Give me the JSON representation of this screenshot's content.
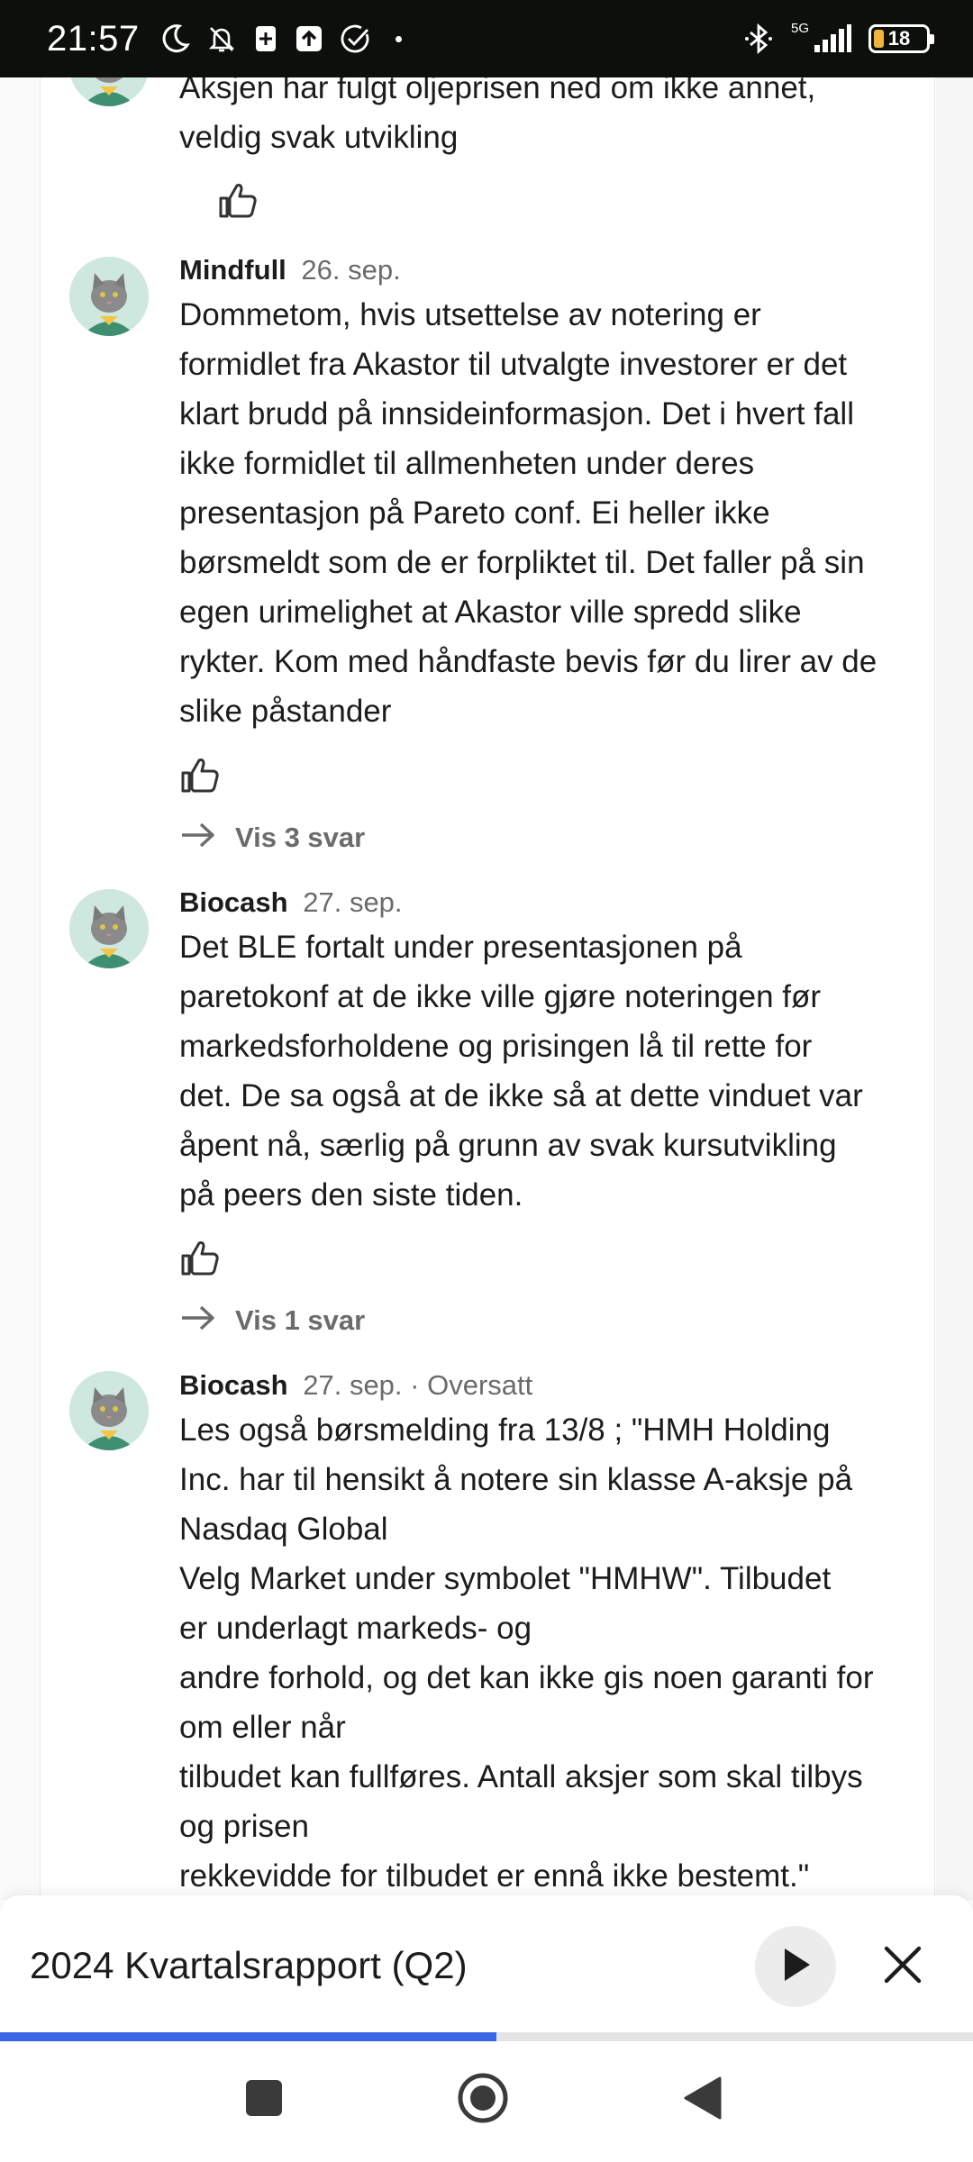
{
  "status_bar": {
    "time": "21:57",
    "network": "5G",
    "battery": "18",
    "battery_level": 0.18
  },
  "comments": [
    {
      "text_lines": [
        "Aksjen har fulgt oljeprisen ned om ikke annet,",
        "veldig svak utvikling"
      ]
    },
    {
      "author": "Mindfull",
      "date": "26. sep.",
      "text_lines": [
        "Dommetom, hvis utsettelse av notering er",
        "formidlet fra Akastor til utvalgte investorer er det",
        "klart brudd på innsideinformasjon. Det i hvert fall",
        "ikke formidlet til allmenheten under deres",
        "presentasjon på Pareto conf. Ei heller ikke",
        "børsmeldt som de er forpliktet til. Det faller på sin",
        "egen urimelighet at Akastor ville spredd slike",
        "rykter. Kom med håndfaste bevis før du lirer av de",
        "slike påstander"
      ],
      "replies_label": "Vis 3 svar"
    },
    {
      "author": "Biocash",
      "date": "27. sep.",
      "text_lines": [
        "Det BLE fortalt under presentasjonen på",
        "paretokonf at de ikke ville gjøre noteringen før",
        "markedsforholdene og prisingen lå til rette for",
        "det. De sa også at de ikke så at dette vinduet var",
        "åpent nå, særlig på grunn av svak kursutvikling",
        "på peers den siste tiden."
      ],
      "replies_label": "Vis 1 svar"
    },
    {
      "author": "Biocash",
      "date": "27. sep.",
      "translated": "· Oversatt",
      "text_lines": [
        "Les også børsmelding fra 13/8 ; \"HMH Holding",
        "Inc. har til hensikt å notere sin klasse A-aksje på",
        "Nasdaq Global",
        "Velg Market under symbolet \"HMHW\". Tilbudet",
        "er underlagt markeds- og",
        "andre forhold, og det kan ikke gis noen garanti for",
        "om eller når",
        "tilbudet kan fullføres. Antall aksjer som skal tilbys",
        "og prisen",
        "rekkevidde for tilbudet er ennå ikke bestemt.\""
      ]
    }
  ],
  "player": {
    "title": "2024 Kvartalsrapport (Q2)",
    "progress": 0.51
  },
  "icons": {
    "like": "thumbs-up-icon",
    "replies": "arrow-right-icon",
    "play": "play-icon",
    "close": "close-icon",
    "nav_recents": "square-icon",
    "nav_home": "circle-icon",
    "nav_back": "triangle-back-icon"
  },
  "colors": {
    "accent": "#3a67e8",
    "status_bar_bg": "#0c0f0c",
    "battery": "#f0b43a",
    "muted_text": "#6b6b6b"
  }
}
